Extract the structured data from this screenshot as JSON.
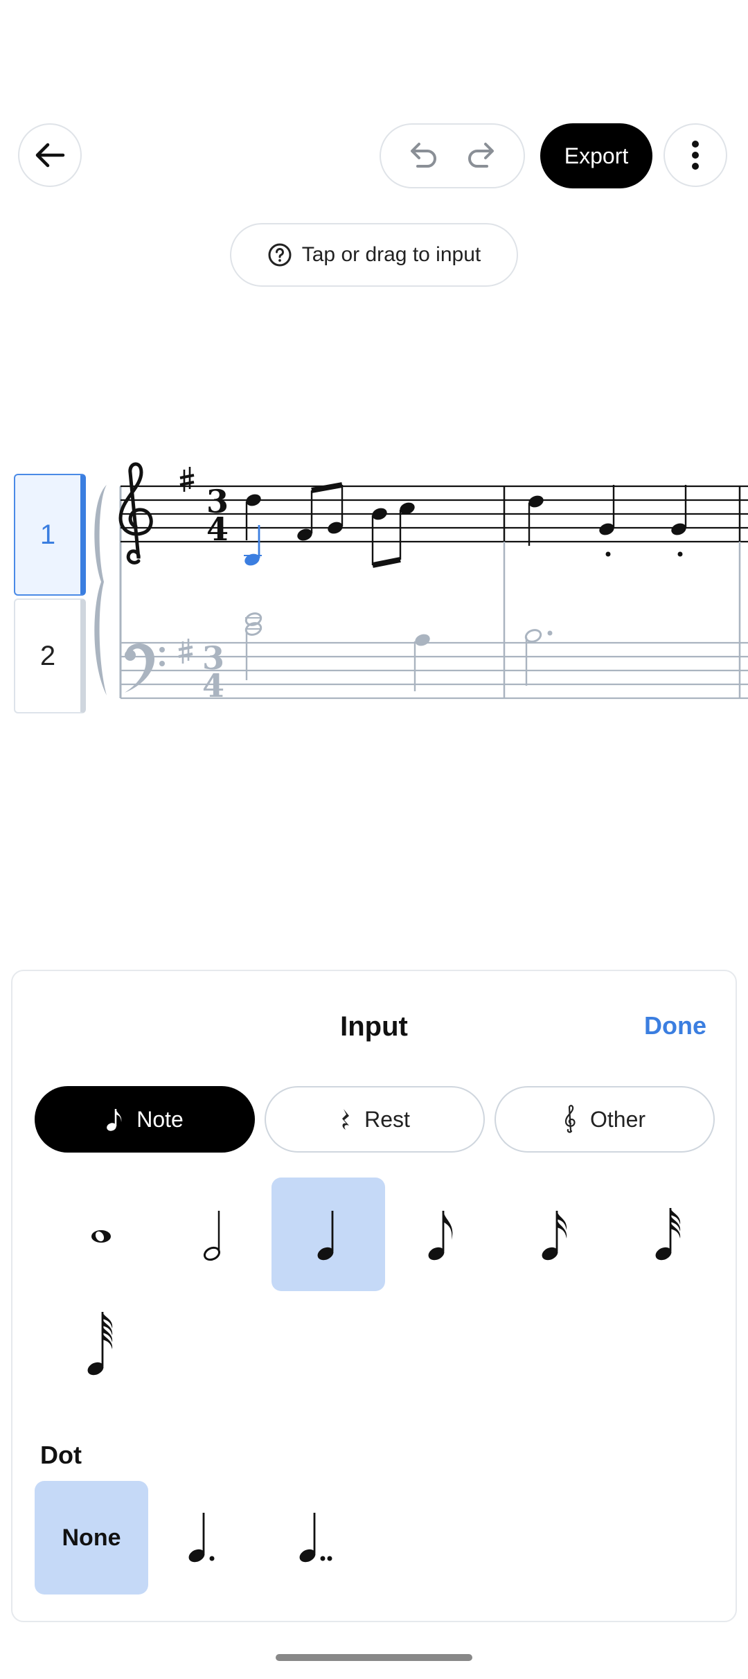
{
  "toolbar": {
    "export_label": "Export"
  },
  "hint": {
    "label": "Tap or drag to input"
  },
  "staff_tabs": [
    {
      "label": "1",
      "selected": true
    },
    {
      "label": "2",
      "selected": false
    }
  ],
  "colors": {
    "accent": "#3b7ee0",
    "selected_bg": "#c5d9f7",
    "inactive_staff": "#aab4c0"
  },
  "panel": {
    "title": "Input",
    "done_label": "Done",
    "modes": [
      {
        "label": "Note",
        "icon": "eighth-note-icon",
        "active": true
      },
      {
        "label": "Rest",
        "icon": "quarter-rest-icon",
        "active": false
      },
      {
        "label": "Other",
        "icon": "treble-clef-icon",
        "active": false
      }
    ],
    "durations": [
      "whole",
      "half",
      "quarter",
      "eighth",
      "sixteenth",
      "thirty-second",
      "sixty-fourth"
    ],
    "selected_duration": "quarter",
    "dot_label": "Dot",
    "dot_options": {
      "none_label": "None",
      "selected": "None",
      "icons": [
        "dotted-quarter-icon",
        "double-dotted-quarter-icon"
      ]
    }
  }
}
